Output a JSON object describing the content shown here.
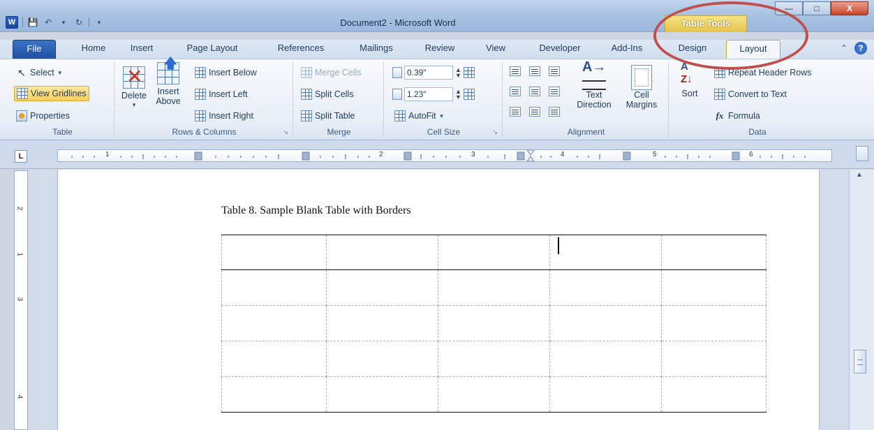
{
  "window": {
    "title": "Document2 - Microsoft Word",
    "context_title": "Table Tools",
    "app_icon": "W"
  },
  "quick_access": [
    "save-icon",
    "undo-icon",
    "redo-icon",
    "customize-icon"
  ],
  "tabs": {
    "file": "File",
    "home": "Home",
    "insert": "Insert",
    "page_layout": "Page Layout",
    "references": "References",
    "mailings": "Mailings",
    "review": "Review",
    "view": "View",
    "developer": "Developer",
    "addins": "Add-Ins",
    "design": "Design",
    "layout": "Layout"
  },
  "ribbon": {
    "table": {
      "label": "Table",
      "select": "Select",
      "view_gridlines": "View Gridlines",
      "properties": "Properties"
    },
    "rows_columns": {
      "label": "Rows & Columns",
      "delete": "Delete",
      "insert_above_1": "Insert",
      "insert_above_2": "Above",
      "insert_below": "Insert Below",
      "insert_left": "Insert Left",
      "insert_right": "Insert Right"
    },
    "merge": {
      "label": "Merge",
      "merge_cells": "Merge Cells",
      "split_cells": "Split Cells",
      "split_table": "Split Table"
    },
    "cell_size": {
      "label": "Cell Size",
      "height": "0.39\"",
      "width": "1.23\"",
      "autofit": "AutoFit"
    },
    "alignment": {
      "label": "Alignment",
      "text_direction_1": "Text",
      "text_direction_2": "Direction",
      "cell_margins_1": "Cell",
      "cell_margins_2": "Margins"
    },
    "data": {
      "label": "Data",
      "sort": "Sort",
      "repeat_header_rows": "Repeat Header Rows",
      "convert_to_text": "Convert to Text",
      "formula": "Formula"
    }
  },
  "ruler": {
    "tab_selector": "L",
    "horizontal_numbers": [
      "1",
      "2",
      "3",
      "4",
      "5",
      "6"
    ],
    "vertical_numbers": [
      "2",
      "1",
      "3",
      "4"
    ]
  },
  "document": {
    "caption": "Table 8. Sample Blank Table with Borders",
    "rows": 5,
    "cols": 5
  },
  "accent_colors": {
    "table_tools": "#e6c447",
    "highlight_oval": "#c0504d"
  }
}
